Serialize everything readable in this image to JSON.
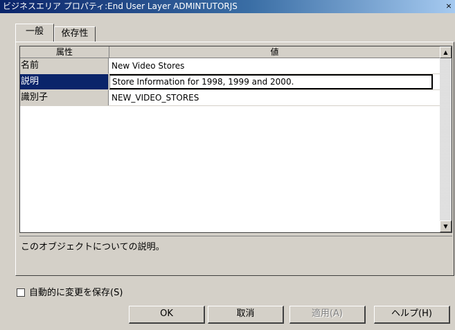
{
  "window": {
    "title": "ビジネスエリア プロパティ:End User Layer  ADMINTUTORJS",
    "close_glyph": "×"
  },
  "tabs": [
    {
      "label": "一般",
      "active": true
    },
    {
      "label": "依存性",
      "active": false
    }
  ],
  "grid": {
    "columns": [
      "属性",
      "値"
    ],
    "rows": [
      {
        "key": "名前",
        "value": "New Video Stores",
        "selected": false
      },
      {
        "key": "説明",
        "value": "Store Information for 1998, 1999 and 2000.",
        "selected": true
      },
      {
        "key": "識別子",
        "value": "NEW_VIDEO_STORES",
        "selected": false
      }
    ]
  },
  "description": "このオブジェクトについての説明。",
  "autosave": {
    "label": "自動的に変更を保存(S)",
    "checked": false
  },
  "buttons": {
    "ok": "OK",
    "cancel": "取消",
    "apply": "適用(A)",
    "help": "ヘルプ(H)"
  }
}
